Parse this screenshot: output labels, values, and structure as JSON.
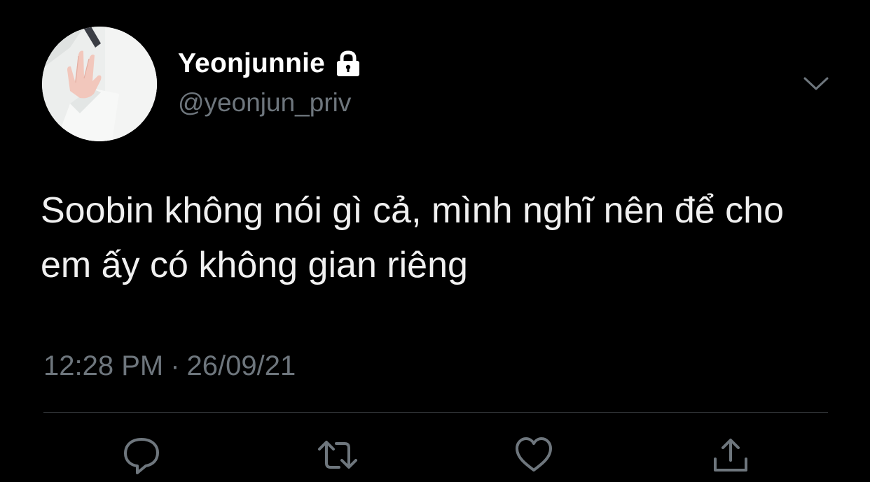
{
  "user": {
    "display_name": "Yeonjunnie",
    "handle": "@yeonjun_priv",
    "protected_icon": "lock-icon",
    "avatar_icon": "avatar"
  },
  "tweet": {
    "text": "Soobin không nói gì cả, mình nghĩ nên để cho em ấy có không gian riêng",
    "time": "12:28 PM",
    "separator": "·",
    "date": "26/09/21"
  },
  "actions": [
    {
      "icon": "reply-icon"
    },
    {
      "icon": "retweet-icon"
    },
    {
      "icon": "like-icon"
    },
    {
      "icon": "share-icon"
    }
  ],
  "menu_icon": "chevron-down-icon",
  "colors": {
    "background": "#000000",
    "primary_text": "#ffffff",
    "secondary_text": "#6e767d",
    "icon": "#6e767d",
    "divider": "#2f3336"
  }
}
